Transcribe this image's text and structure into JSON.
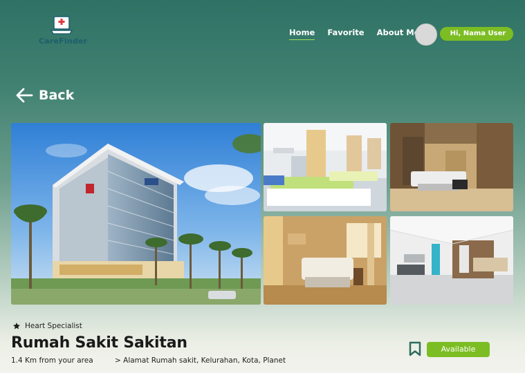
{
  "header": {
    "brand": "CareFinder",
    "nav": [
      {
        "label": "Home",
        "active": true
      },
      {
        "label": "Favorite",
        "active": false
      },
      {
        "label": "About Me",
        "active": false
      }
    ],
    "user_greeting": "Hi, Nama User"
  },
  "back_label": "Back",
  "gallery": {
    "images": [
      "hospital-building-photo",
      "patient-ward-photo",
      "private-room-photo",
      "suite-room-photo",
      "lobby-photo"
    ]
  },
  "hospital": {
    "specialty": "Heart Specialist",
    "name": "Rumah Sakit Sakitan",
    "distance": "1.4 Km from your area",
    "address": "> Alamat Rumah sakit, Kelurahan, Kota, Planet",
    "status": "Available"
  },
  "colors": {
    "accent_green": "#7cbd23",
    "header_teal": "#2f7265",
    "brand_text": "#1d5e6e"
  }
}
